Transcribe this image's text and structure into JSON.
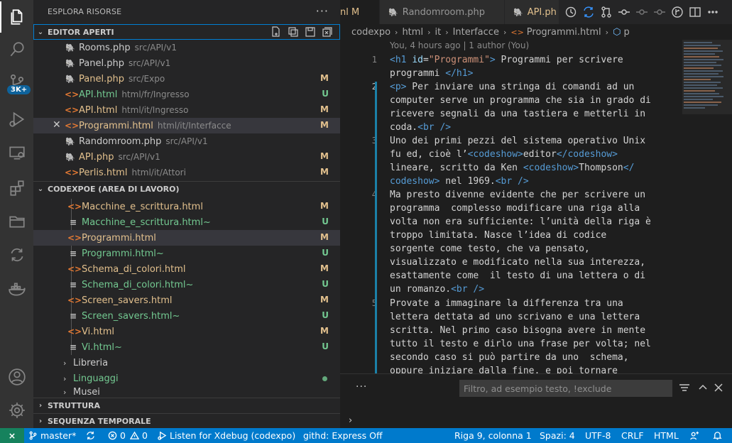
{
  "activity_bar": {
    "icons": [
      "explorer-icon",
      "search-icon",
      "source-control-icon",
      "run-debug-icon",
      "remote-explorer-icon",
      "extensions-icon",
      "folder-icon",
      "live-share-icon",
      "docker-icon",
      "accounts-icon",
      "manage-gear-icon"
    ],
    "source_control_badge": "3K+"
  },
  "sidebar": {
    "title": "ESPLORA RISORSE",
    "more": "···",
    "open_editors": {
      "title": "EDITOR APERTI",
      "items": [
        {
          "name": "Rooms.php",
          "path": "src/API/v1",
          "type": "php",
          "status": "",
          "color": "default"
        },
        {
          "name": "Panel.php",
          "path": "src/API/v1",
          "type": "php",
          "status": "",
          "color": "default"
        },
        {
          "name": "Panel.php",
          "path": "src/Expo",
          "type": "php",
          "status": "M",
          "color": "modified"
        },
        {
          "name": "API.html",
          "path": "html/fr/Ingresso",
          "type": "html",
          "status": "U",
          "color": "untracked"
        },
        {
          "name": "API.html",
          "path": "html/it/Ingresso",
          "type": "html",
          "status": "M",
          "color": "modified"
        },
        {
          "name": "Programmi.html",
          "path": "html/it/Interfacce",
          "type": "html",
          "status": "M",
          "color": "modified"
        },
        {
          "name": "Randomroom.php",
          "path": "src/API/v1",
          "type": "php",
          "status": "",
          "color": "default"
        },
        {
          "name": "API.php",
          "path": "src/API/v1",
          "type": "php",
          "status": "M",
          "color": "modified"
        },
        {
          "name": "Perlis.html",
          "path": "html/it/Attori",
          "type": "html",
          "status": "M",
          "color": "modified"
        }
      ]
    },
    "workspace": {
      "title": "CODEXPOE (AREA DI LAVORO)",
      "files": [
        {
          "name": "Macchine_e_scrittura.html",
          "type": "html",
          "status": "M",
          "color": "modified"
        },
        {
          "name": "Macchine_e_scrittura.html~",
          "type": "txt",
          "status": "U",
          "color": "untracked"
        },
        {
          "name": "Programmi.html",
          "type": "html",
          "status": "M",
          "color": "modified"
        },
        {
          "name": "Programmi.html~",
          "type": "txt",
          "status": "U",
          "color": "untracked"
        },
        {
          "name": "Schema_di_colori.html",
          "type": "html",
          "status": "M",
          "color": "modified"
        },
        {
          "name": "Schema_di_colori.html~",
          "type": "txt",
          "status": "U",
          "color": "untracked"
        },
        {
          "name": "Screen_savers.html",
          "type": "html",
          "status": "M",
          "color": "modified"
        },
        {
          "name": "Screen_savers.html~",
          "type": "txt",
          "status": "U",
          "color": "untracked"
        },
        {
          "name": "Vi.html",
          "type": "html",
          "status": "M",
          "color": "modified"
        },
        {
          "name": "Vi.html~",
          "type": "txt",
          "status": "U",
          "color": "untracked"
        }
      ],
      "folders": [
        {
          "name": "Libreria",
          "color": "default"
        },
        {
          "name": "Linguaggi",
          "color": "untracked"
        },
        {
          "name": "Musei",
          "color": "default"
        }
      ]
    },
    "outline_title": "STRUTTURA",
    "timeline_title": "SEQUENZA TEMPORALE"
  },
  "tabs": {
    "items": [
      {
        "label": "nl M",
        "active": true
      },
      {
        "label": "Randomroom.php",
        "active": false
      },
      {
        "label": "API.ph",
        "active": false
      }
    ]
  },
  "breadcrumb": [
    "codexpo",
    "html",
    "it",
    "Interfacce",
    "Programmi.html",
    "p"
  ],
  "editor": {
    "blame": "You, 4 hours ago | 1 author (You)",
    "line_numbers": [
      "1",
      "2",
      "3",
      "4",
      "5"
    ]
  },
  "panel": {
    "more": "···",
    "filter_placeholder": "Filtro, ad esempio testo, !exclude",
    "prompt": "›"
  },
  "status_bar": {
    "remote": "⨯",
    "branch": "master*",
    "errors": "0",
    "warnings": "0",
    "xdebug": "Listen for Xdebug (codexpo)",
    "githd": "githd: Express Off",
    "position": "Riga 9, colonna 1",
    "spaces": "Spazi: 4",
    "encoding": "UTF-8",
    "eol": "CRLF",
    "language": "HTML"
  },
  "colors": {
    "accent": "#007acc",
    "modified": "#e2c08d",
    "untracked": "#73c991",
    "remote": "#16825d"
  }
}
